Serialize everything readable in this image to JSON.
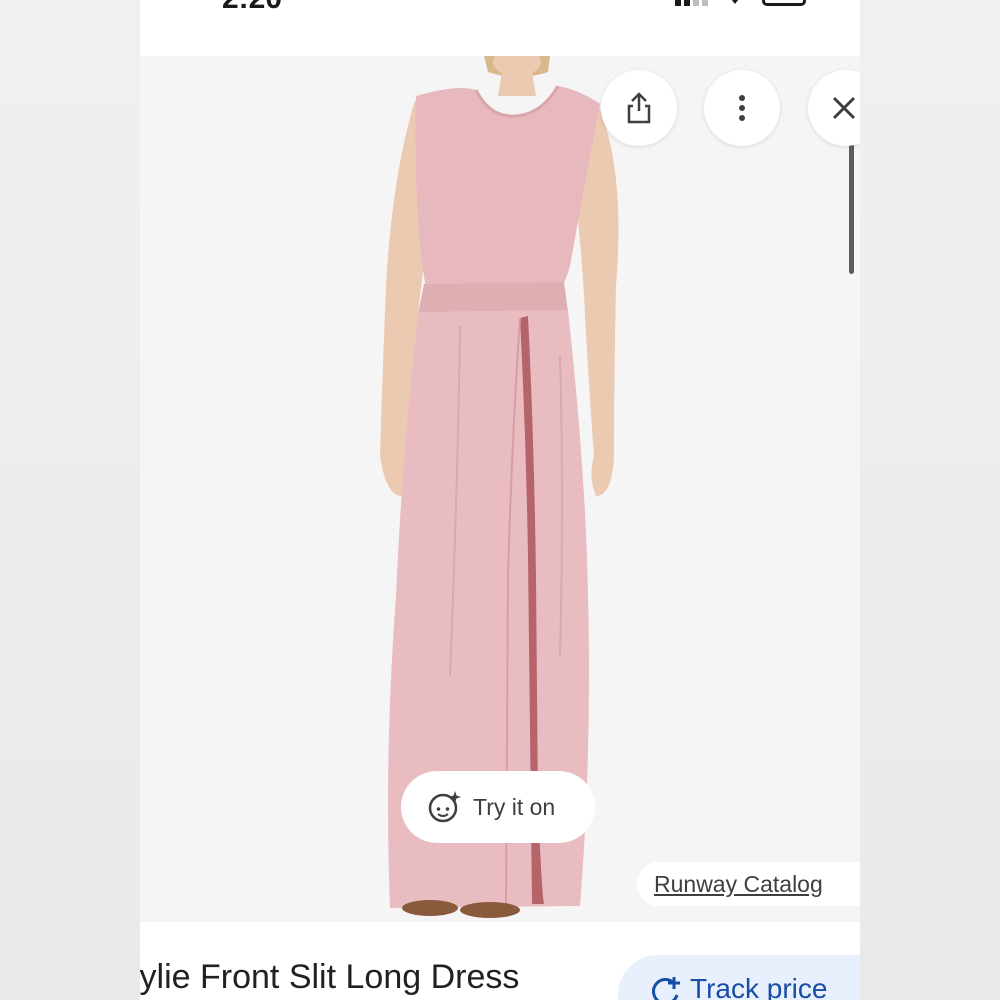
{
  "status_bar": {
    "time": "2:20"
  },
  "product": {
    "title": "lylie Front Slit Long Dress",
    "image_alt": "Model wearing a pink sleeveless maxi dress with a front slit",
    "colors": {
      "dress": "#e7b8bd",
      "skin": "#eccab2"
    }
  },
  "actions": {
    "share_icon": "share-icon",
    "more_icon": "more-vert-icon",
    "close_icon": "close-icon",
    "try_it_on": "Try it on",
    "try_it_on_icon": "face-sparkle-icon",
    "track_price": "Track price",
    "track_price_icon": "price-track-icon"
  },
  "attribution": {
    "source": "Runway Catalog"
  },
  "theme": {
    "accent": "#174ea6",
    "accent_bg": "#e8f0fe"
  }
}
